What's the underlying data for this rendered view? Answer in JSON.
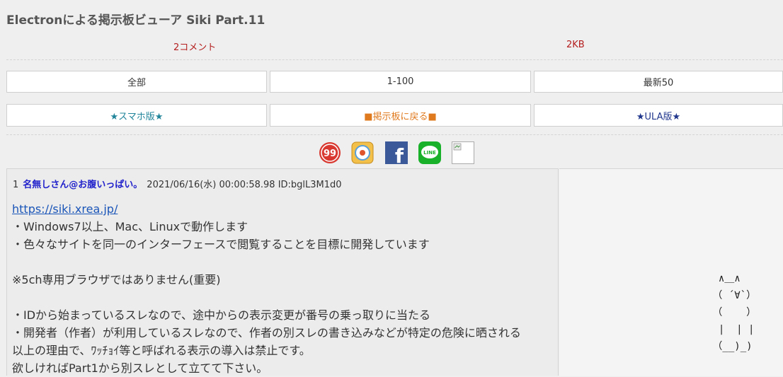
{
  "page": {
    "title": "Electronによる掲示板ビューア Siki Part.11"
  },
  "meta": {
    "comments": "2コメント",
    "size": "2KB"
  },
  "nav_row1": [
    {
      "label": "全部"
    },
    {
      "label": "1-100"
    },
    {
      "label": "最新50"
    }
  ],
  "nav_row2": [
    {
      "label": "★スマホ版★",
      "color": "#20849a"
    },
    {
      "label": "■掲示板に戻る■",
      "color": "#e07a1f"
    },
    {
      "label": "★ULA版★",
      "color": "#20368c"
    }
  ],
  "share_icons": [
    "99-icon",
    "ipad-app-icon",
    "facebook-icon",
    "line-icon",
    "broken-image-icon"
  ],
  "share": {
    "line_label": "LINE",
    "f_glyph": "f",
    "n99": "99"
  },
  "post": {
    "number": "1",
    "name": "名無しさん@お腹いっぱい。",
    "date": "2021/06/16(水) 00:00:58.98 ID:bglL3M1d0",
    "link": "https://siki.xrea.jp/",
    "lines": [
      "・Windows7以上、Mac、Linuxで動作します",
      "・色々なサイトを同一のインターフェースで閲覧することを目標に開発しています",
      "",
      "※5ch専用ブラウザではありません(重要)",
      "",
      "・IDから始まっているスレなので、途中からの表示変更が番号の乗っ取りに当たる",
      "・開発者（作者）が利用しているスレなので、作者の別スレの書き込みなどが特定の危険に晒される",
      "以上の理由で、ﾜｯﾁｮｲ等と呼ばれる表示の導入は禁止です。",
      "欲しければPart1から別スレとして立てて下さい。"
    ]
  },
  "ascii_art": "  ∧＿∧\n （ ´∀`）\n （    ）\n  |  | |\n （__)_)"
}
